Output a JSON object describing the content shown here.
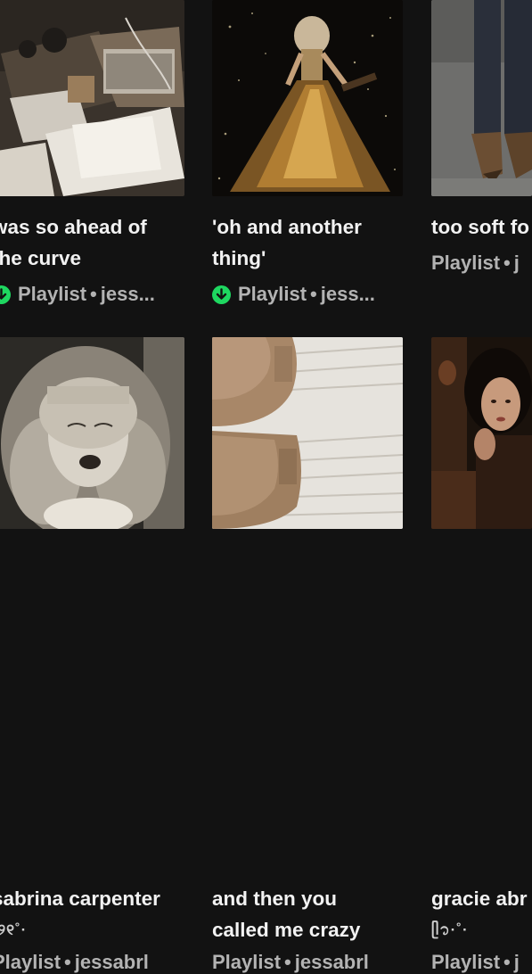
{
  "playlists": [
    {
      "title_lines": [
        "was so ahead of",
        "the curve"
      ],
      "type": "Playlist",
      "owner": "jess...",
      "downloaded": true,
      "cover": "desk-with-headphones-papers"
    },
    {
      "title_lines": [
        "'oh and another",
        "thing'"
      ],
      "type": "Playlist",
      "owner": "jess...",
      "downloaded": true,
      "cover": "singer-in-gold-sequin-gown"
    },
    {
      "title_lines": [
        "too soft fo"
      ],
      "type": "Playlist",
      "owner": "j",
      "downloaded": false,
      "cover": "jeans-and-brown-boots"
    },
    {
      "title_lines": [
        "sabrina carpenter",
        "˚୨୧˚·"
      ],
      "type": "Playlist",
      "owner": "jessabrl",
      "downloaded": false,
      "cover": "blonde-woman-black-and-white"
    },
    {
      "title_lines": [
        "and then you",
        "called me crazy"
      ],
      "type": "Playlist",
      "owner": "jessabrl",
      "downloaded": false,
      "cover": "ugg-boots-white-sweater"
    },
    {
      "title_lines": [
        "gracie abr",
        "ᥫ᭡·˚·"
      ],
      "type": "Playlist",
      "owner": "j",
      "downloaded": false,
      "cover": "dark-haired-woman-portrait"
    }
  ],
  "separator": "•",
  "colors": {
    "background": "#121212",
    "title": "#f2f2f2",
    "meta": "#b3b3b3",
    "download_green": "#1ed760"
  }
}
